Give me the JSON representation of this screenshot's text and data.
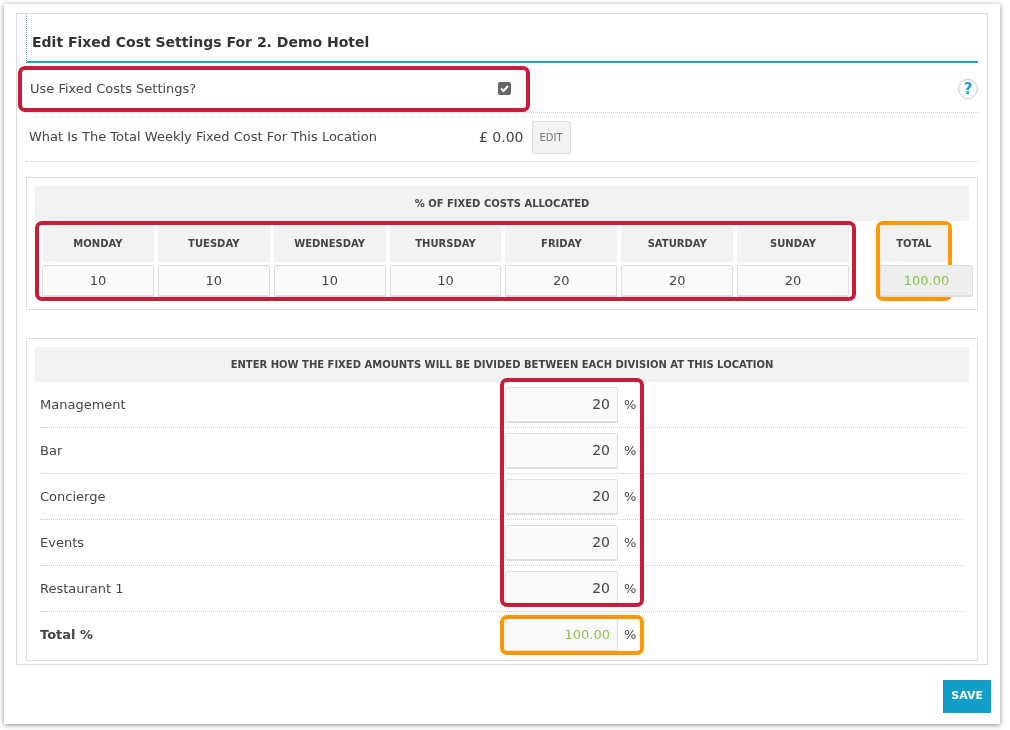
{
  "title": "Edit Fixed Cost Settings For 2. Demo Hotel",
  "use_fixed_costs": {
    "label": "Use Fixed Costs Settings?",
    "checked": true,
    "highlight": {
      "color": "#c41e3a"
    }
  },
  "help": {
    "symbol": "?"
  },
  "weekly_cost": {
    "label": "What Is The Total Weekly Fixed Cost For This Location",
    "value": "£ 0.00",
    "button": "EDIT"
  },
  "allocation": {
    "heading": "% OF FIXED COSTS ALLOCATED",
    "highlight": {
      "color": "#c41e3a"
    },
    "days": [
      {
        "label": "MONDAY",
        "value": "10"
      },
      {
        "label": "TUESDAY",
        "value": "10"
      },
      {
        "label": "WEDNESDAY",
        "value": "10"
      },
      {
        "label": "THURSDAY",
        "value": "10"
      },
      {
        "label": "FRIDAY",
        "value": "20"
      },
      {
        "label": "SATURDAY",
        "value": "20"
      },
      {
        "label": "SUNDAY",
        "value": "20"
      }
    ],
    "total": {
      "label": "TOTAL",
      "value": "100.00",
      "highlight": {
        "color": "#ff9800"
      }
    }
  },
  "divisions": {
    "heading": "ENTER HOW THE FIXED AMOUNTS WILL BE DIVIDED BETWEEN EACH DIVISION AT THIS LOCATION",
    "highlight": {
      "color": "#c41e3a"
    },
    "rows": [
      {
        "label": "Management",
        "value": "20",
        "unit": "%"
      },
      {
        "label": "Bar",
        "value": "20",
        "unit": "%"
      },
      {
        "label": "Concierge",
        "value": "20",
        "unit": "%"
      },
      {
        "label": "Events",
        "value": "20",
        "unit": "%"
      },
      {
        "label": "Restaurant 1",
        "value": "20",
        "unit": "%"
      }
    ],
    "total": {
      "label": "Total %",
      "value": "100.00",
      "unit": "%",
      "highlight": {
        "color": "#ff9800"
      }
    }
  },
  "save_button": "SAVE"
}
